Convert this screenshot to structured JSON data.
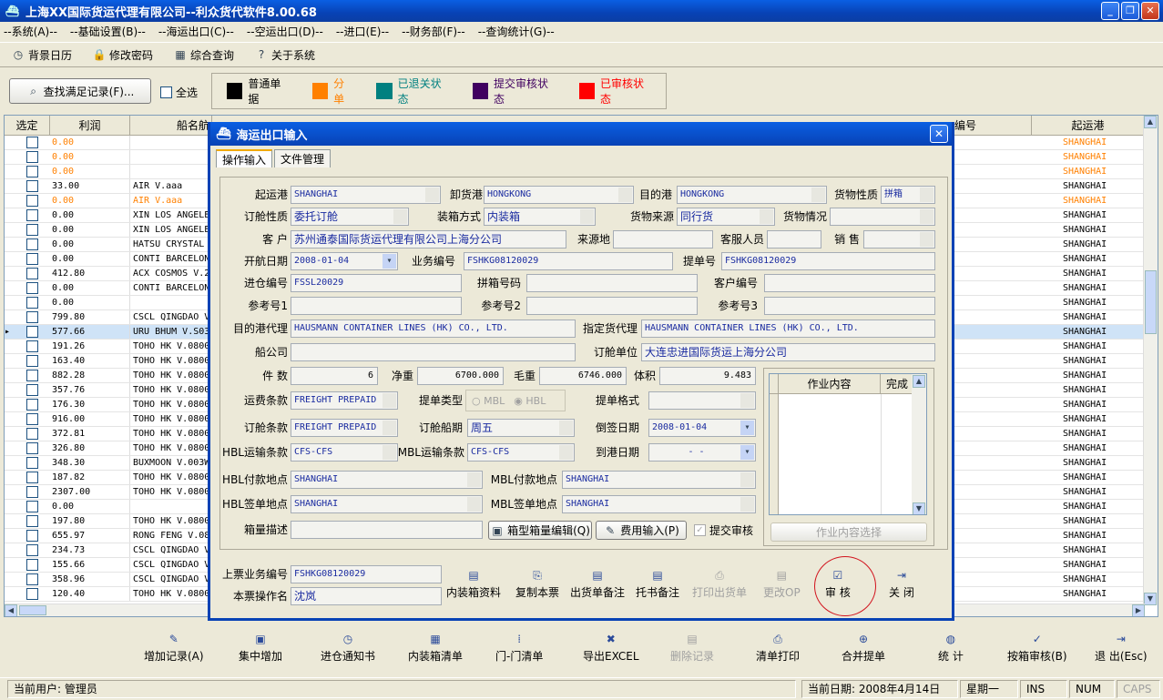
{
  "window": {
    "title": "上海XX国际货运代理有限公司--利众货代软件8.00.68"
  },
  "menu": [
    "--系统(A)--",
    "--基础设置(B)--",
    "--海运出口(C)--",
    "--空运出口(D)--",
    "--进口(E)--",
    "--财务部(F)--",
    "--查询统计(G)--"
  ],
  "toolbar": [
    {
      "label": "背景日历",
      "icon": "clock-icon"
    },
    {
      "label": "修改密码",
      "icon": "lock-icon"
    },
    {
      "label": "综合查询",
      "icon": "grid-icon"
    },
    {
      "label": "关于系统",
      "icon": "help-icon"
    }
  ],
  "search": {
    "button": "查找满足记录(F)...",
    "select_all": "全选"
  },
  "legend": [
    {
      "label": "普通单据",
      "color": "#000000"
    },
    {
      "label": "分单",
      "color": "#ff8000"
    },
    {
      "label": "已退关状态",
      "color": "#008080"
    },
    {
      "label": "提交审核状态",
      "color": "#400060"
    },
    {
      "label": "已审核状态",
      "color": "#ff0000"
    }
  ],
  "grid": {
    "headers": {
      "select": "选定",
      "profit": "利润",
      "ship": "船名航",
      "booking": "编号",
      "port": "起运港"
    },
    "rows": [
      {
        "profit": "0.00",
        "ship": "",
        "port": "SHANGHAI",
        "color": "#ff8000"
      },
      {
        "profit": "0.00",
        "ship": "",
        "port": "SHANGHAI",
        "color": "#ff8000"
      },
      {
        "profit": "0.00",
        "ship": "",
        "port": "SHANGHAI",
        "color": "#ff8000"
      },
      {
        "profit": "33.00",
        "ship": "AIR V.aaa",
        "port": "SHANGHAI",
        "color": "#000000"
      },
      {
        "profit": "0.00",
        "ship": "AIR V.aaa",
        "port": "SHANGHAI",
        "color": "#ff8000"
      },
      {
        "profit": "0.00",
        "ship": "XIN LOS ANGELE",
        "port": "SHANGHAI",
        "color": "#000000"
      },
      {
        "profit": "0.00",
        "ship": "XIN LOS ANGELE",
        "port": "SHANGHAI",
        "color": "#000000"
      },
      {
        "profit": "0.00",
        "ship": "HATSU CRYSTAL",
        "port": "SHANGHAI",
        "color": "#000000"
      },
      {
        "profit": "0.00",
        "ship": "CONTI BARCELON",
        "port": "SHANGHAI",
        "color": "#000000"
      },
      {
        "profit": "412.80",
        "ship": "ACX COSMOS V.2",
        "port": "SHANGHAI",
        "color": "#000000"
      },
      {
        "profit": "0.00",
        "ship": "CONTI BARCELON",
        "port": "SHANGHAI",
        "color": "#000000"
      },
      {
        "profit": "0.00",
        "ship": "",
        "port": "SHANGHAI",
        "color": "#000000"
      },
      {
        "profit": "799.80",
        "ship": "CSCL QINGDAO V",
        "port": "SHANGHAI",
        "color": "#000000"
      },
      {
        "profit": "577.66",
        "ship": "URU BHUM V.S03",
        "port": "SHANGHAI",
        "color": "#000000",
        "selected": true
      },
      {
        "profit": "191.26",
        "ship": "TOHO HK V.0800",
        "port": "SHANGHAI",
        "color": "#000000"
      },
      {
        "profit": "163.40",
        "ship": "TOHO HK V.0800",
        "port": "SHANGHAI",
        "color": "#000000"
      },
      {
        "profit": "882.28",
        "ship": "TOHO HK V.0800",
        "port": "SHANGHAI",
        "color": "#000000"
      },
      {
        "profit": "357.76",
        "ship": "TOHO HK V.0800",
        "port": "SHANGHAI",
        "color": "#000000"
      },
      {
        "profit": "176.30",
        "ship": "TOHO HK V.0800",
        "port": "SHANGHAI",
        "color": "#000000"
      },
      {
        "profit": "916.00",
        "ship": "TOHO HK V.0800",
        "port": "SHANGHAI",
        "color": "#000000"
      },
      {
        "profit": "372.81",
        "ship": "TOHO HK V.0800",
        "port": "SHANGHAI",
        "color": "#000000"
      },
      {
        "profit": "326.80",
        "ship": "TOHO HK V.0800",
        "port": "SHANGHAI",
        "color": "#000000"
      },
      {
        "profit": "348.30",
        "ship": "BUXMOON V.003W",
        "port": "SHANGHAI",
        "color": "#000000"
      },
      {
        "profit": "187.82",
        "ship": "TOHO HK V.0800",
        "port": "SHANGHAI",
        "color": "#000000"
      },
      {
        "profit": "2307.00",
        "ship": "TOHO HK V.0800",
        "port": "SHANGHAI",
        "color": "#000000"
      },
      {
        "profit": "0.00",
        "ship": "",
        "port": "SHANGHAI",
        "color": "#000000"
      },
      {
        "profit": "197.80",
        "ship": "TOHO HK V.0800",
        "port": "SHANGHAI",
        "color": "#000000"
      },
      {
        "profit": "655.97",
        "ship": "RONG FENG V.08",
        "port": "SHANGHAI",
        "color": "#000000"
      },
      {
        "profit": "234.73",
        "ship": "CSCL QINGDAO V",
        "port": "SHANGHAI",
        "color": "#000000"
      },
      {
        "profit": "155.66",
        "ship": "CSCL QINGDAO V",
        "port": "SHANGHAI",
        "color": "#000000"
      },
      {
        "profit": "358.96",
        "ship": "CSCL QINGDAO V",
        "port": "SHANGHAI",
        "color": "#000000"
      },
      {
        "profit": "120.40",
        "ship": "TOHO HK V.0800",
        "port": "SHANGHAI",
        "color": "#000000"
      }
    ]
  },
  "dialog": {
    "title": "海运出口输入",
    "tabs": [
      "操作输入",
      "文件管理"
    ],
    "labels": {
      "pol": "起运港",
      "pod": "卸货港",
      "dest": "目的港",
      "cargo_nature": "货物性质",
      "booking_nature": "订舱性质",
      "packing": "装箱方式",
      "cargo_source": "货物来源",
      "cargo_status": "货物情况",
      "customer": "客 户",
      "origin": "来源地",
      "cs_staff": "客服人员",
      "sales": "销 售",
      "etd": "开航日期",
      "biz_no": "业务编号",
      "bl_no": "提单号",
      "in_no": "进仓编号",
      "consol_no": "拼箱号码",
      "cust_no": "客户编号",
      "ref1": "参考号1",
      "ref2": "参考号2",
      "ref3": "参考号3",
      "agent": "目的港代理",
      "nominated_agent": "指定货代理",
      "carrier": "船公司",
      "booking_party": "订舱单位",
      "pieces": "件 数",
      "net_weight": "净重",
      "gross_weight": "毛重",
      "volume": "体积",
      "freight_terms": "运费条款",
      "bl_type": "提单类型",
      "bl_format": "提单格式",
      "booking_terms": "订舱条款",
      "sailing_day": "订舱船期",
      "backdate": "倒签日期",
      "hbl_terms": "HBL运输条款",
      "mbl_terms": "MBL运输条款",
      "eta": "到港日期",
      "hbl_pay": "HBL付款地点",
      "mbl_pay": "MBL付款地点",
      "hbl_issue": "HBL签单地点",
      "mbl_issue": "MBL签单地点",
      "container_desc": "箱量描述",
      "prev_biz": "上票业务编号",
      "operator": "本票操作名"
    },
    "values": {
      "pol": "SHANGHAI",
      "pod": "HONGKONG",
      "dest": "HONGKONG",
      "cargo_nature": "拼箱",
      "booking_nature": "委托订舱",
      "packing": "内装箱",
      "cargo_source": "同行货",
      "customer": "苏州通泰国际货运代理有限公司上海分公司",
      "etd": "2008-01-04",
      "biz_no": "FSHKG08120029",
      "bl_no": "FSHKG08120029",
      "in_no": "FSSL20029",
      "agent": "HAUSMANN CONTAINER LINES (HK) CO., LTD.",
      "nominated_agent": "HAUSMANN CONTAINER LINES (HK) CO., LTD.",
      "booking_party": "大连忠进国际货运上海分公司",
      "pieces": "6",
      "net_weight": "6700.000",
      "gross_weight": "6746.000",
      "volume": "9.483",
      "freight_terms": "FREIGHT PREPAID",
      "booking_terms": "FREIGHT PREPAID",
      "sailing_day": "周五",
      "backdate": "2008-01-04",
      "hbl_terms": "CFS-CFS",
      "mbl_terms": "CFS-CFS",
      "eta": "- -",
      "hbl_pay": "SHANGHAI",
      "mbl_pay": "SHANGHAI",
      "hbl_issue": "SHANGHAI",
      "mbl_issue": "SHANGHAI",
      "prev_biz": "FSHKG08120029",
      "operator": "沈岚"
    },
    "bl_options": [
      "MBL",
      "HBL"
    ],
    "work": {
      "col_content": "作业内容",
      "col_done": "完成",
      "select_btn": "作业内容选择"
    },
    "buttons": {
      "container_edit": "箱型箱量编辑(Q)",
      "fee_input": "费用输入(P)",
      "submit_audit": "提交审核"
    },
    "actions": [
      {
        "label": "内装箱资料",
        "enabled": true
      },
      {
        "label": "复制本票",
        "enabled": true
      },
      {
        "label": "出货单备注",
        "enabled": true
      },
      {
        "label": "托书备注",
        "enabled": true
      },
      {
        "label": "打印出货单",
        "enabled": false
      },
      {
        "label": "更改OP",
        "enabled": false
      },
      {
        "label": "审 核",
        "enabled": true
      },
      {
        "label": "关 闭",
        "enabled": true
      }
    ]
  },
  "bottom": [
    {
      "label": "增加记录(A)",
      "enabled": true
    },
    {
      "label": "集中增加",
      "enabled": true
    },
    {
      "label": "进仓通知书",
      "enabled": true
    },
    {
      "label": "内装箱清单",
      "enabled": true
    },
    {
      "label": "门-门清单",
      "enabled": true
    },
    {
      "label": "导出EXCEL",
      "enabled": true
    },
    {
      "label": "删除记录",
      "enabled": false
    },
    {
      "label": "清单打印",
      "enabled": true
    },
    {
      "label": "合并提单",
      "enabled": true
    },
    {
      "label": "统 计",
      "enabled": true
    },
    {
      "label": "按箱审核(B)",
      "enabled": true
    },
    {
      "label": "退 出(Esc)",
      "enabled": true
    }
  ],
  "status": {
    "user": "当前用户: 管理员",
    "date": "当前日期: 2008年4月14日",
    "weekday": "星期一",
    "ins": "INS",
    "num": "NUM",
    "caps": "CAPS"
  }
}
